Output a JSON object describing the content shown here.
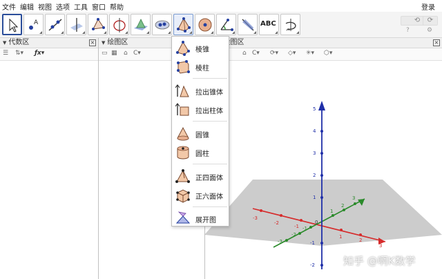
{
  "menubar": {
    "items": [
      "文件",
      "编辑",
      "视图",
      "选项",
      "工具",
      "窗口",
      "帮助"
    ],
    "login": "登录"
  },
  "toolbar": {
    "tools": [
      {
        "name": "move-tool",
        "icon": "arrow-cursor-icon",
        "selected": true
      },
      {
        "name": "point-tool",
        "icon": "point-A-icon"
      },
      {
        "name": "line-tool",
        "icon": "line-icon"
      },
      {
        "name": "perpendicular-tool",
        "icon": "perpendicular-line-icon"
      },
      {
        "name": "polygon-tool",
        "icon": "polygon-icon"
      },
      {
        "name": "circle-axis-tool",
        "icon": "circle-axis-icon"
      },
      {
        "name": "sphere-plane-tool",
        "icon": "sphere-icon"
      },
      {
        "name": "intersect-tool",
        "icon": "intersect-curve-icon"
      },
      {
        "name": "pyramid-tool",
        "icon": "pyramid-icon",
        "open": true
      },
      {
        "name": "sphere-tool",
        "icon": "sphere-center-icon"
      },
      {
        "name": "angle-tool",
        "icon": "angle-icon"
      },
      {
        "name": "reflect-tool",
        "icon": "reflect-plane-icon"
      },
      {
        "name": "text-tool",
        "icon": "text-ABC-icon",
        "label": "ABC"
      },
      {
        "name": "rotate-view-tool",
        "icon": "rotate-view-icon"
      }
    ],
    "undo": "⟲",
    "redo": "⟳",
    "help_icon": "?",
    "settings_icon": "⚙"
  },
  "panels": {
    "algebra": {
      "title": "代数区",
      "close": "×"
    },
    "graphics": {
      "title": "绘图区",
      "close": "×"
    },
    "graphics3d": {
      "title": "3D绘图区",
      "close": "×"
    }
  },
  "dropdown": {
    "items": [
      {
        "label": "棱锥",
        "icon": "pyramid-icon"
      },
      {
        "label": "棱柱",
        "icon": "prism-icon"
      },
      {
        "label": "拉出锥体",
        "icon": "extrude-pyramid-icon"
      },
      {
        "label": "拉出柱体",
        "icon": "extrude-prism-icon"
      },
      {
        "label": "圆锥",
        "icon": "cone-icon"
      },
      {
        "label": "圆柱",
        "icon": "cylinder-icon"
      },
      {
        "label": "正四面体",
        "icon": "tetrahedron-icon"
      },
      {
        "label": "正六面体",
        "icon": "cube-icon"
      },
      {
        "label": "展开图",
        "icon": "net-icon"
      }
    ]
  },
  "axes3d": {
    "z_ticks": [
      "5",
      "4",
      "3",
      "2",
      "1",
      "-1",
      "-2"
    ],
    "x_ticks": [
      "-3",
      "-2",
      "-1",
      "1",
      "2",
      "3"
    ],
    "y_ticks": [
      "-3",
      "-2",
      "-1",
      "1",
      "2",
      "3"
    ],
    "origin_label": "0",
    "colors": {
      "x": "#d62b2b",
      "y": "#2a8a2a",
      "z": "#1f2fa8",
      "plane": "#b0b0b0"
    }
  },
  "watermark": "知乎 @啊K数学"
}
